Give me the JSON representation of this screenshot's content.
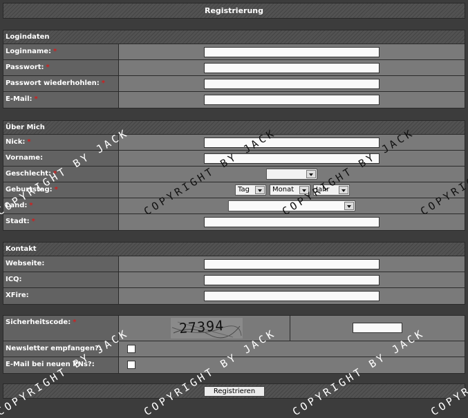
{
  "title": "Registrierung",
  "sections": {
    "login": {
      "heading": "Logindaten",
      "fields": [
        "Loginname:",
        "Passwort:",
        "Passwort wiederhohlen:",
        "E-Mail:"
      ]
    },
    "about": {
      "heading": "Über Mich",
      "fields": [
        "Nick:",
        "Vorname:",
        "Geschlecht:",
        "Geburtstag:",
        "Land:",
        "Stadt:"
      ],
      "birthday": {
        "day": "Tag",
        "month": "Monat",
        "year": "Jahr"
      }
    },
    "contact": {
      "heading": "Kontakt",
      "fields": [
        "Webseite:",
        "ICQ:",
        "XFire:"
      ]
    },
    "security": {
      "captcha_label": "Sicherheitscode:",
      "captcha_code": "27394",
      "newsletter_label": "Newsletter empfangen?:",
      "pn_label": "E-Mail bei neuen PNs?:"
    }
  },
  "required_mark": "*",
  "submit_label": "Registrieren",
  "watermark": "COPYRIGHT BY JACK",
  "colors": {
    "required": "#d21e1e",
    "background": "#3c3c3c"
  }
}
